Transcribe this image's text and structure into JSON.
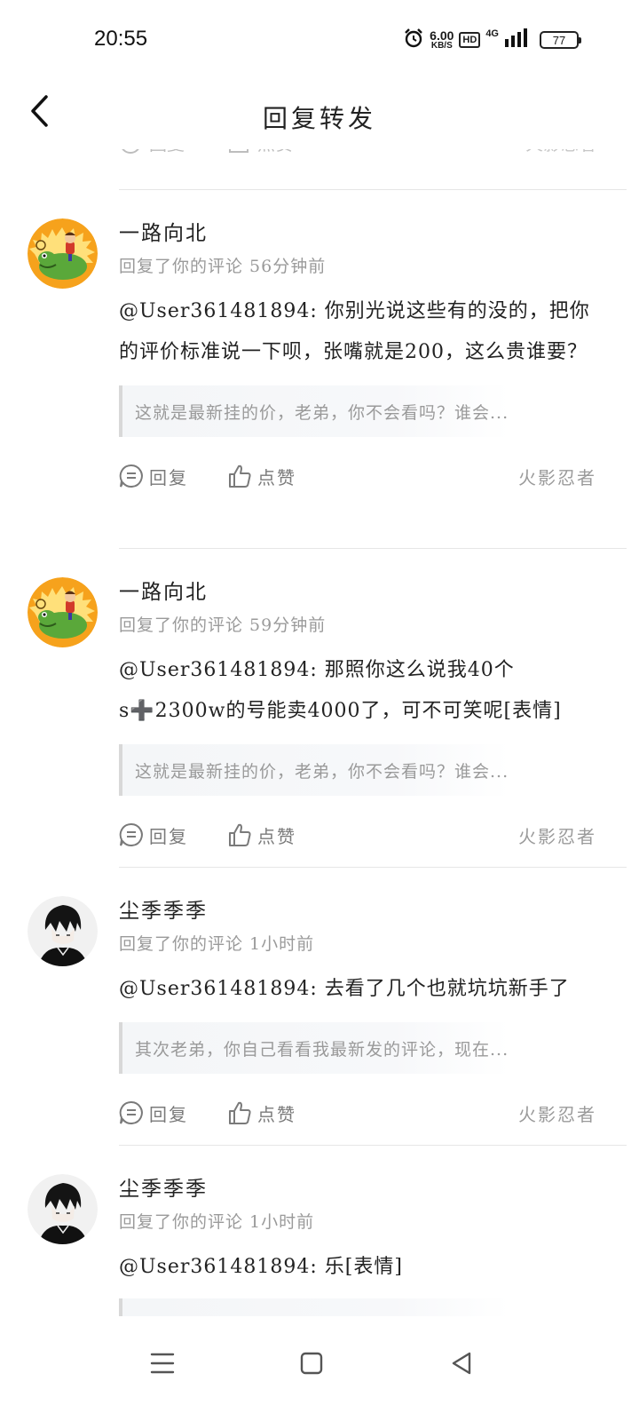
{
  "status_bar": {
    "time": "20:55",
    "net_speed_value": "6.00",
    "net_speed_unit": "KB/S",
    "hd_label": "HD",
    "network_type": "4G",
    "battery_level": "77",
    "icons": [
      "alarm-icon",
      "signal-icon",
      "battery-icon"
    ]
  },
  "header": {
    "title": "回复转发",
    "back_icon": "chevron-left-icon"
  },
  "actions": {
    "reply_label": "回复",
    "like_label": "点赞"
  },
  "comments": [
    {
      "username": "一路向北",
      "meta": "回复了你的评论 56分钟前",
      "text": "@User361481894: 你别光说这些有的没的，把你的评价标准说一下呗，张嘴就是200，这么贵谁要？",
      "quote": "这就是最新挂的价，老弟，你不会看吗？谁会...",
      "source": "火影忍者",
      "avatar": "frog-rider-avatar"
    },
    {
      "username": "一路向北",
      "meta": "回复了你的评论 59分钟前",
      "text": "@User361481894: 那照你这么说我40个s➕2300w的号能卖4000了，可不可笑呢[表情]",
      "quote": "这就是最新挂的价，老弟，你不会看吗？谁会...",
      "source": "火影忍者",
      "avatar": "frog-rider-avatar"
    },
    {
      "username": "尘季季季",
      "meta": "回复了你的评论 1小时前",
      "text": "@User361481894: 去看了几个也就坑坑新手了",
      "quote": "其次老弟，你自己看看我最新发的评论，现在...",
      "source": "火影忍者",
      "avatar": "anime-boy-avatar"
    },
    {
      "username": "尘季季季",
      "meta": "回复了你的评论 1小时前",
      "text": "@User361481894: 乐[表情]",
      "avatar": "anime-boy-avatar"
    }
  ],
  "nav_bar": {
    "icons": [
      "menu-icon",
      "home-square-icon",
      "back-triangle-icon"
    ]
  },
  "colors": {
    "text_primary": "#222222",
    "text_secondary": "#9a9a9a",
    "divider": "#e6e6e6",
    "quote_bg": "#f4f6f8"
  }
}
